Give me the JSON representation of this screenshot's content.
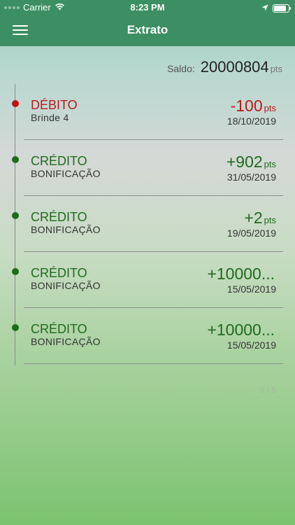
{
  "status_bar": {
    "carrier": "Carrier",
    "time": "8:23 PM",
    "icons": [
      "signal-dots-icon",
      "wifi-icon",
      "location-arrow-icon",
      "battery-icon"
    ]
  },
  "header": {
    "title": "Extrato",
    "menu_icon": "hamburger-menu-icon",
    "background": "#3c8f62"
  },
  "balance": {
    "label": "Saldo:",
    "value": "20000804",
    "unit": "pts"
  },
  "transactions": [
    {
      "type": "DÉBITO",
      "description": "Brinde 4",
      "amount": "-100",
      "unit": "pts",
      "date": "18/10/2019",
      "kind": "debit"
    },
    {
      "type": "CRÉDITO",
      "description": "BONIFICAÇÃO",
      "amount": "+902",
      "unit": "pts",
      "date": "31/05/2019",
      "kind": "credit"
    },
    {
      "type": "CRÉDITO",
      "description": "BONIFICAÇÃO",
      "amount": "+2",
      "unit": "pts",
      "date": "19/05/2019",
      "kind": "credit"
    },
    {
      "type": "CRÉDITO",
      "description": "BONIFICAÇÃO",
      "amount": "+10000...",
      "unit": "",
      "date": "15/05/2019",
      "kind": "credit"
    },
    {
      "type": "CRÉDITO",
      "description": "BONIFICAÇÃO",
      "amount": "+10000...",
      "unit": "",
      "date": "15/05/2019",
      "kind": "credit"
    }
  ],
  "pagination": {
    "text": "5 / 5"
  },
  "colors": {
    "debit": "#c01010",
    "credit": "#1e6b1c",
    "accent": "#3c8f62"
  }
}
